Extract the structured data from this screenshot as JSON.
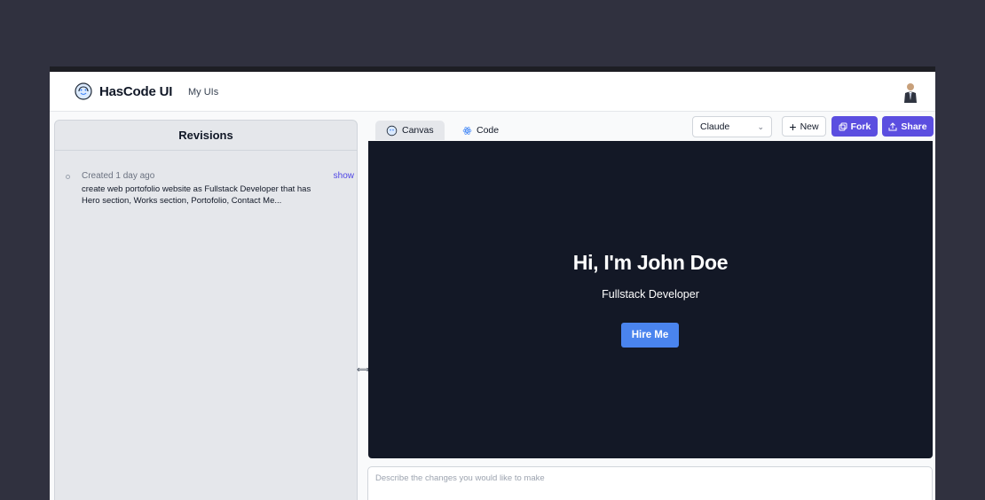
{
  "header": {
    "brand": "HasCode UI",
    "nav_link": "My UIs"
  },
  "sidebar": {
    "title": "Revisions",
    "revisions": [
      {
        "date": "Created 1 day ago",
        "action": "show",
        "text": "create web portofolio website as Fullstack Developer that has Hero section, Works section, Portofolio, Contact Me..."
      }
    ]
  },
  "tabs": [
    {
      "label": "Canvas",
      "icon": "brain-icon",
      "active": true
    },
    {
      "label": "Code",
      "icon": "react-atom-icon",
      "active": false
    }
  ],
  "toolbar": {
    "model_select": "Claude",
    "new_label": "New",
    "fork_label": "Fork",
    "share_label": "Share"
  },
  "preview": {
    "title": "Hi, I'm John Doe",
    "subtitle": "Fullstack Developer",
    "cta": "Hire Me"
  },
  "prompt": {
    "placeholder": "Describe the changes you would like to make"
  },
  "colors": {
    "accent": "#5b4ee0",
    "canvas_bg": "#131826",
    "hero_button": "#4a84ee",
    "backdrop": "#30313f"
  }
}
